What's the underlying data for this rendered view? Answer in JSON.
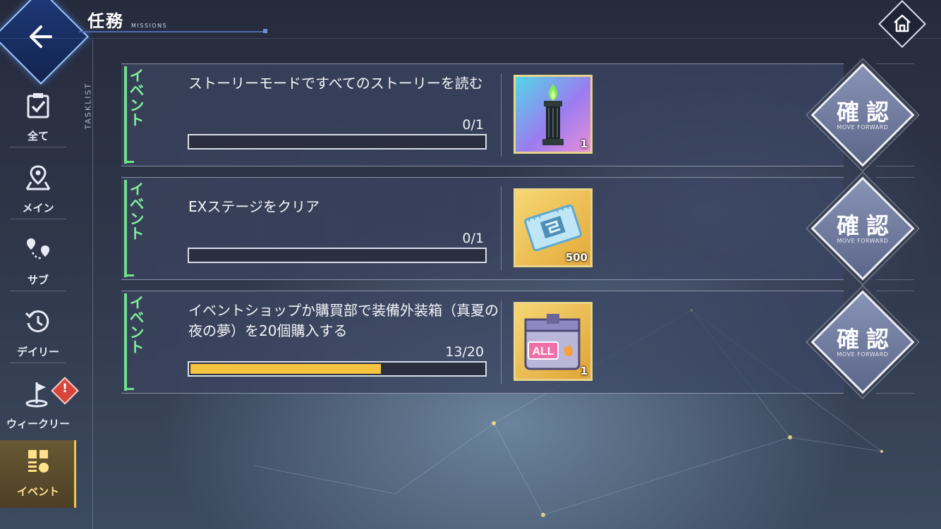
{
  "header": {
    "title": "任務",
    "subtitle": "MISSIONS",
    "back_icon": "arrow-left-icon",
    "home_icon": "home-icon"
  },
  "sidebar": {
    "tasklist_label": "TASKLIST",
    "items": [
      {
        "label": "全て",
        "icon": "clipboard-check-icon",
        "active": false
      },
      {
        "label": "メイン",
        "icon": "map-pin-icon",
        "active": false
      },
      {
        "label": "サブ",
        "icon": "route-pins-icon",
        "active": false
      },
      {
        "label": "デイリー",
        "icon": "history-clock-icon",
        "active": false
      },
      {
        "label": "ウィークリー",
        "icon": "flag-icon",
        "active": false,
        "alert": "!"
      },
      {
        "label": "イベント",
        "icon": "event-icon",
        "active": true
      }
    ]
  },
  "missions": [
    {
      "tag": "イベント",
      "text": "ストーリーモードですべてのストーリーを読む",
      "progress_text": "0/1",
      "progress": 0.0,
      "reward_icon": "green-flame-pillar-icon",
      "reward_qty": "1",
      "confirm_label": "確認",
      "confirm_sub": "MOVE FORWARD"
    },
    {
      "tag": "イベント",
      "text": "EXステージをクリア",
      "progress_text": "0/1",
      "progress": 0.0,
      "reward_icon": "chip-ticket-icon",
      "reward_qty": "500",
      "confirm_label": "確認",
      "confirm_sub": "MOVE FORWARD"
    },
    {
      "tag": "イベント",
      "text": "イベントショップか購買部で装備外装箱（真夏の夜の夢）を20個購入する",
      "progress_text": "13/20",
      "progress": 0.65,
      "reward_icon": "all-crate-icon",
      "reward_qty": "1",
      "confirm_label": "確認",
      "confirm_sub": "MOVE FORWARD"
    }
  ],
  "colors": {
    "accent_green": "#7ef09a",
    "progress_fill": "#f4c43e",
    "active_tab": "#f3c64a",
    "back_button": "#1e3a7a"
  }
}
